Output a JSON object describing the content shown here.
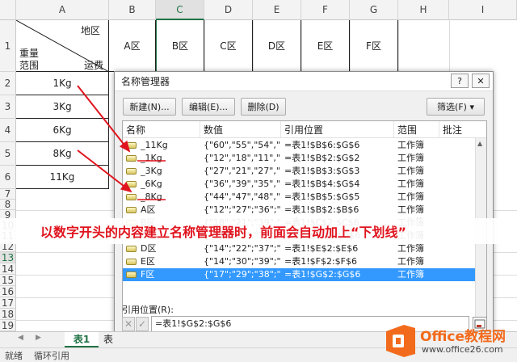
{
  "columns": [
    "A",
    "B",
    "C",
    "D",
    "E",
    "F",
    "G",
    "H",
    "I"
  ],
  "rows": [
    "1",
    "2",
    "3",
    "4",
    "5",
    "6",
    "7",
    "8",
    "9",
    "10",
    "11",
    "12",
    "13",
    "14",
    "15",
    "16",
    "17",
    "18",
    "19",
    "20"
  ],
  "header_cell": {
    "top_right": "地区",
    "left_line1": "重量",
    "left_line2": "范围",
    "bottom_right": "运费"
  },
  "zones": [
    "A区",
    "B区",
    "C区",
    "D区",
    "E区",
    "F区"
  ],
  "weights": [
    "1Kg",
    "3Kg",
    "6Kg",
    "8Kg",
    "11Kg"
  ],
  "dialog": {
    "title": "名称管理器",
    "help_label": "?",
    "close_label": "✕",
    "buttons": {
      "new": "新建(N)...",
      "edit": "编辑(E)...",
      "delete": "删除(D)",
      "filter": "筛选(F) ▾"
    },
    "columns": {
      "name": "名称",
      "value": "数值",
      "ref": "引用位置",
      "scope": "范围",
      "comment": "批注"
    },
    "items": [
      {
        "name": "_11Kg",
        "value": "{\"60\",\"55\",\"54\",\"...",
        "ref": "=表1!$B$6:$G$6",
        "scope": "工作簿"
      },
      {
        "name": "_1Kg",
        "value": "{\"12\",\"18\",\"11\",\"...",
        "ref": "=表1!$B$2:$G$2",
        "scope": "工作簿"
      },
      {
        "name": "_3Kg",
        "value": "{\"27\",\"21\",\"27\",\"...",
        "ref": "=表1!$B$3:$G$3",
        "scope": "工作簿"
      },
      {
        "name": "_6Kg",
        "value": "{\"36\",\"39\",\"35\",\"...",
        "ref": "=表1!$B$4:$G$4",
        "scope": "工作簿"
      },
      {
        "name": "_8Kg",
        "value": "{\"44\",\"47\",\"48\",\"...",
        "ref": "=表1!$B$5:$G$5",
        "scope": "工作簿"
      },
      {
        "name": "A区",
        "value": "{\"12\";\"27\";\"36\";\"...",
        "ref": "=表1!$B$2:$B$6",
        "scope": "工作簿"
      },
      {
        "name": "B区",
        "value": "{\"18\";\"21\";\"39\";\"...",
        "ref": "=表1!$C$2:$C$6",
        "scope": "工作簿"
      },
      {
        "name": "C区",
        "value": "{\"11\";\"27\";\"35\";\"...",
        "ref": "=表1!$D$2:$D$6",
        "scope": "工作簿"
      },
      {
        "name": "D区",
        "value": "{\"14\";\"22\";\"37\";\"...",
        "ref": "=表1!$E$2:$E$6",
        "scope": "工作簿"
      },
      {
        "name": "E区",
        "value": "{\"14\";\"30\";\"39\";\"...",
        "ref": "=表1!$F$2:$F$6",
        "scope": "工作簿"
      },
      {
        "name": "F区",
        "value": "{\"17\";\"29\";\"38\";\"...",
        "ref": "=表1!$G$2:$G$6",
        "scope": "工作簿"
      }
    ],
    "ref_label": "引用位置(R):",
    "ref_value": "=表1!$G$2:$G$6"
  },
  "annotation": "以数字开头的内容建立名称管理器时，前面会自动加上“下划线”",
  "sheet_tabs": [
    "表1",
    "表"
  ],
  "status": {
    "ready": "就绪",
    "circular": "循环引用"
  },
  "watermark": {
    "brand": "Office教程网",
    "url": "www.office26.com"
  },
  "colors": {
    "accent": "#217346",
    "selection": "#3399ff",
    "annotation": "#e0141e",
    "logo": "#f26a1b"
  }
}
